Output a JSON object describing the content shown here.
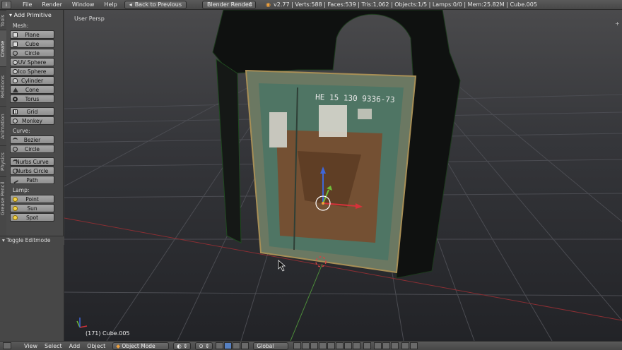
{
  "topbar": {
    "menus": [
      "File",
      "Render",
      "Window",
      "Help"
    ],
    "back_button": "Back to Previous",
    "engine": "Blender Render",
    "stats": "v2.77 | Verts:588 | Faces:539 | Tris:1,062 | Objects:1/5 | Lamps:0/0 | Mem:25.82M | Cube.005"
  },
  "left_tabs": [
    "Tools",
    "Create",
    "Relations",
    "Animation",
    "Physics",
    "Grease Pencil"
  ],
  "toolshelf": {
    "header": "Add Primitive",
    "mesh_label": "Mesh:",
    "mesh": [
      "Plane",
      "Cube",
      "Circle",
      "UV Sphere",
      "Ico Sphere",
      "Cylinder",
      "Cone",
      "Torus"
    ],
    "mesh2": [
      "Grid",
      "Monkey"
    ],
    "curve_label": "Curve:",
    "curve": [
      "Bezier",
      "Circle"
    ],
    "curve2": [
      "Nurbs Curve",
      "Nurbs Circle",
      "Path"
    ],
    "lamp_label": "Lamp:",
    "lamp": [
      "Point",
      "Sun",
      "Spot"
    ]
  },
  "toggle_editmode": "Toggle Editmode",
  "viewport": {
    "label": "User Persp",
    "object_label": "(171) Cube.005",
    "door_text": "НЕ 15 130 9336-73"
  },
  "bottombar": {
    "menus": [
      "View",
      "Select",
      "Add",
      "Object"
    ],
    "mode": "Object Mode",
    "orientation": "Global"
  },
  "colors": {
    "x_axis": "#c13a3a",
    "y_axis": "#6fbf3a",
    "z_axis": "#3f66d8",
    "selected": "#f0a13c"
  }
}
